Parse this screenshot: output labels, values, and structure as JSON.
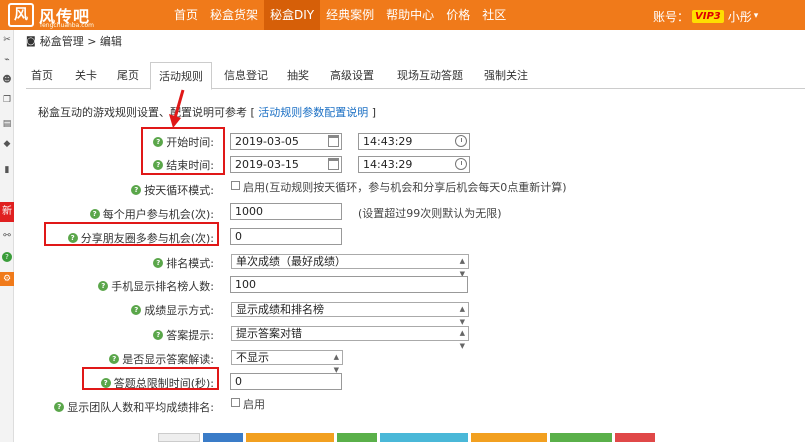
{
  "header": {
    "logo_mark": "风",
    "logo_text": "风传吧",
    "logo_sub": "fengchuanba.com",
    "nav": [
      "首页",
      "秘盒货架",
      "秘盒DIY",
      "经典案例",
      "帮助中心",
      "价格",
      "社区"
    ],
    "active_nav": 2,
    "account_label": "账号：",
    "vip": "VIP3",
    "account_name": "小彤"
  },
  "sidebar": {
    "new_label": "新"
  },
  "breadcrumb": "秘盒管理 > 编辑",
  "tabs": [
    "首页",
    "关卡",
    "尾页",
    "活动规则",
    "信息登记",
    "抽奖",
    "高级设置",
    "现场互动答题",
    "强制关注"
  ],
  "active_tab": 3,
  "intro": {
    "text": "秘盒互动的游戏规则设置、配置说明可参考 [ ",
    "link": "活动规则参数配置说明",
    "end": " ]"
  },
  "form": {
    "start_label": "开始时间:",
    "start_date": "2019-03-05",
    "start_time": "14:43:29",
    "end_label": "结束时间:",
    "end_date": "2019-03-15",
    "end_time": "14:43:29",
    "daily_label": "按天循环模式:",
    "daily_text": "启用(互动规则按天循环，参与机会和分享后机会每天0点重新计算)",
    "chances_label": "每个用户参与机会(次):",
    "chances_value": "1000",
    "chances_note": "(设置超过99次则默认为无限)",
    "share_label": "分享朋友圈多参与机会(次):",
    "share_value": "0",
    "rank_label": "排名模式:",
    "rank_value": "单次成绩（最好成绩）",
    "mobile_rank_label": "手机显示排名榜人数:",
    "mobile_rank_value": "100",
    "score_label": "成绩显示方式:",
    "score_value": "显示成绩和排名榜",
    "hint_label": "答案提示:",
    "hint_value": "提示答案对错",
    "explain_label": "是否显示答案解读:",
    "explain_value": "不显示",
    "timelimit_label": "答题总限制时间(秒):",
    "timelimit_value": "0",
    "team_label": "显示团队人数和平均成绩排名:",
    "team_text": "启用"
  },
  "colors": {
    "brand": "#f07a1a",
    "highlight": "#e01818",
    "link": "#1a6fc4",
    "help": "#5aa64a"
  }
}
